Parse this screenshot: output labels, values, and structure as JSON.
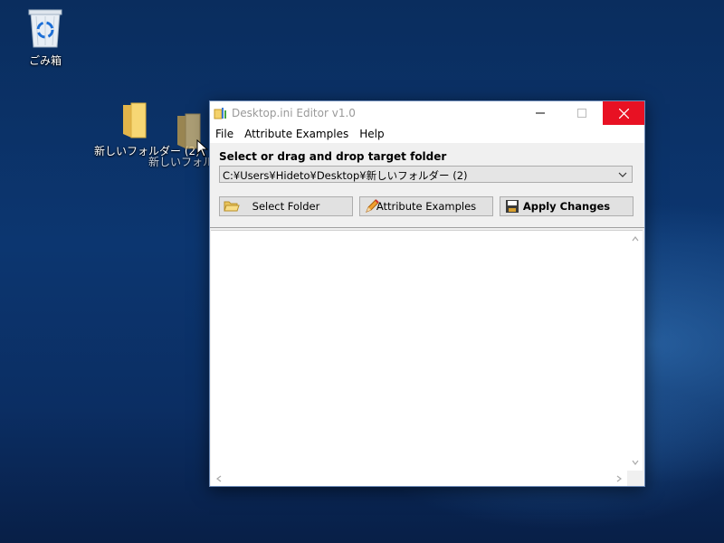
{
  "desktop": {
    "recycle_bin_label": "ごみ箱",
    "folder1_label": "新しいフォルダー (2)",
    "folder2_label": "新しいフォルダー (2)",
    "background_color": "#0c3670"
  },
  "window": {
    "title": "Desktop.ini Editor v1.0",
    "menu": [
      "File",
      "Attribute Examples",
      "Help"
    ],
    "section_label": "Select or drag and drop target folder",
    "path_value": "C:¥Users¥Hideto¥Desktop¥新しいフォルダー (2)",
    "buttons": {
      "select_folder": "Select Folder",
      "attribute_examples": "Attribute Examples",
      "apply_changes": "Apply Changes"
    },
    "content": "",
    "close_color": "#e81123"
  },
  "icons": {
    "recycle_bin": "recycle-bin-icon",
    "folder": "folder-icon",
    "cursor": "mouse-pointer-icon",
    "app": "app-icon",
    "open_folder": "open-folder-icon",
    "pencil": "pencil-icon",
    "save": "save-icon"
  }
}
